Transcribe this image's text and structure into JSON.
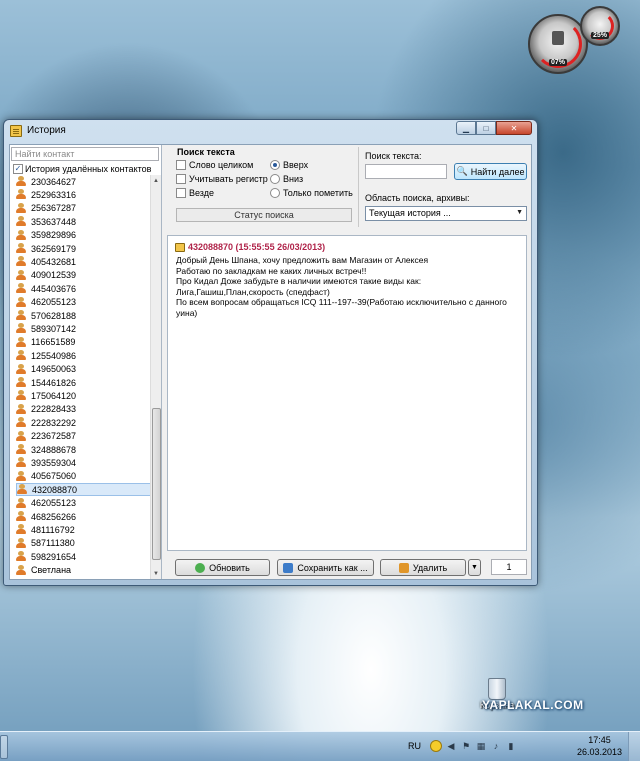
{
  "gadget": {
    "cpu": "07%",
    "ram": "25%"
  },
  "window": {
    "title": "История"
  },
  "contacts_pane": {
    "search_placeholder": "Найти контакт",
    "deleted_label": "История удалённых контактов",
    "deleted_checked": true,
    "items": [
      "230364627",
      "252963316",
      "256367287",
      "353637448",
      "359829896",
      "362569179",
      "405432681",
      "409012539",
      "445403676",
      "462055123",
      "570628188",
      "589307142",
      "116651589",
      "125540986",
      "149650063",
      "154461826",
      "175064120",
      "222828433",
      "222832292",
      "223672587",
      "324888678",
      "393559304",
      "405675060",
      "432088870",
      "462055123",
      "468256266",
      "481116792",
      "587111380",
      "598291654",
      "Светлана"
    ],
    "selected": "432088870"
  },
  "search": {
    "title": "Поиск текста",
    "whole_word": "Слово целиком",
    "match_case": "Учитывать регистр",
    "everywhere": "Везде",
    "up": "Вверх",
    "down": "Вниз",
    "mark_only": "Только пометить",
    "direction_selected": "up",
    "status": "Статус поиска",
    "text_label": "Поиск текста:",
    "text_value": "",
    "find_next": "Найти далее",
    "scope_label": "Область поиска, архивы:",
    "scope_value": "Текущая история ..."
  },
  "message": {
    "header": "432088870 (15:55:55 26/03/2013)",
    "lines": [
      "Добрый День Шпана, хочу предложить вам Магазин от Алексея",
      "Работаю по закладкам не каких личных встреч!!",
      "Про Кидал Доже забудьте в наличии имеются такие виды как:",
      "Лига,Гашиш,План,скорость (спедфаст)",
      "По всем вопросам обращаться ICQ 111--197--39(Работаю исключительно с данного уина)"
    ]
  },
  "buttons": {
    "refresh": "Обновить",
    "save_as": "Сохранить как ...",
    "delete": "Удалить",
    "count": "1"
  },
  "desktop": {
    "recycle_bin": "Корзина",
    "watermark": "YAPLAKAL.COM"
  },
  "taskbar": {
    "lang": "RU",
    "time": "17:45",
    "date": "26.03.2013"
  },
  "colors": {
    "message_header": "#b0244a",
    "accent": "#3c7fb1"
  }
}
